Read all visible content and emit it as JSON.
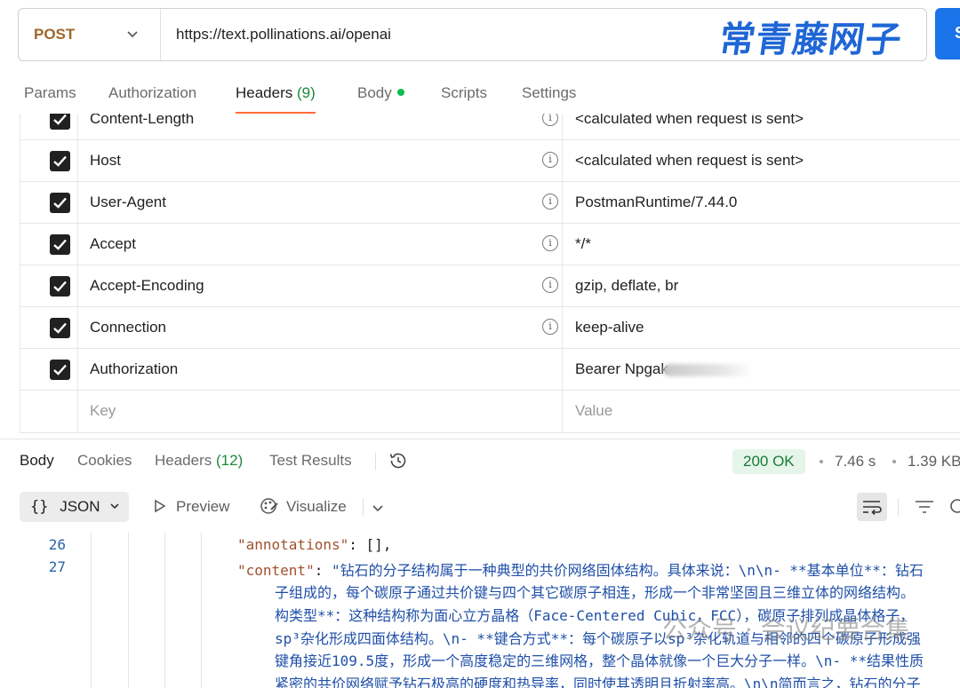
{
  "request": {
    "method": "POST",
    "url": "https://text.pollinations.ai/openai",
    "send_label": "S"
  },
  "watermark_top": "常青藤网子",
  "request_tabs": [
    {
      "label": "Params"
    },
    {
      "label": "Authorization"
    },
    {
      "label": "Headers",
      "count": "(9)"
    },
    {
      "label": "Body"
    },
    {
      "label": "Scripts"
    },
    {
      "label": "Settings"
    }
  ],
  "active_request_tab": "Headers",
  "headers": [
    {
      "key": "Content-Length",
      "value": "<calculated when request is sent>",
      "checked": true,
      "info": true
    },
    {
      "key": "Host",
      "value": "<calculated when request is sent>",
      "checked": true,
      "info": true
    },
    {
      "key": "User-Agent",
      "value": "PostmanRuntime/7.44.0",
      "checked": true,
      "info": true
    },
    {
      "key": "Accept",
      "value": "*/*",
      "checked": true,
      "info": true
    },
    {
      "key": "Accept-Encoding",
      "value": "gzip, deflate, br",
      "checked": true,
      "info": true
    },
    {
      "key": "Connection",
      "value": "keep-alive",
      "checked": true,
      "info": true
    },
    {
      "key": "Authorization",
      "value": "Bearer Npgak",
      "checked": true,
      "info": false
    }
  ],
  "new_header": {
    "key_placeholder": "Key",
    "value_placeholder": "Value"
  },
  "response_tabs": [
    {
      "label": "Body"
    },
    {
      "label": "Cookies"
    },
    {
      "label": "Headers",
      "count": "(12)"
    },
    {
      "label": "Test Results"
    }
  ],
  "response_meta": {
    "status": "200 OK",
    "time": "7.46 s",
    "size": "1.39 KB"
  },
  "response_toolbar": {
    "format_braces": "{}",
    "format": "JSON",
    "preview": "Preview",
    "visualize": "Visualize"
  },
  "code": {
    "line26_no": "26",
    "line26_key": "\"annotations\"",
    "line26_rest": ": [],",
    "line27_no": "27",
    "line27_key": "\"content\"",
    "line27_colon": ": ",
    "content_lines": [
      "\"钻石的分子结构属于一种典型的共价网络固体结构。具体来说：\\n\\n- **基本单位**：钻石",
      "子组成的，每个碳原子通过共价键与四个其它碳原子相连，形成一个非常坚固且三维立体的网络结构。",
      "构类型**：这种结构称为面心立方晶格（Face-Centered Cubic，FCC），碳原子排列成晶体格子，",
      "sp³杂化形成四面体结构。\\n- **键合方式**：每个碳原子以sp³杂化轨道与相邻的四个碳原子形成强",
      "键角接近109.5度，形成一个高度稳定的三维网格，整个晶体就像一个巨大分子一样。\\n- **结果性质",
      "紧密的共价网络赋予钻石极高的硬度和热导率，同时使其透明且折射率高。\\n\\n简而言之，钻石的分子"
    ]
  },
  "watermark_bottom": "公众号 · 会议纪要合集"
}
